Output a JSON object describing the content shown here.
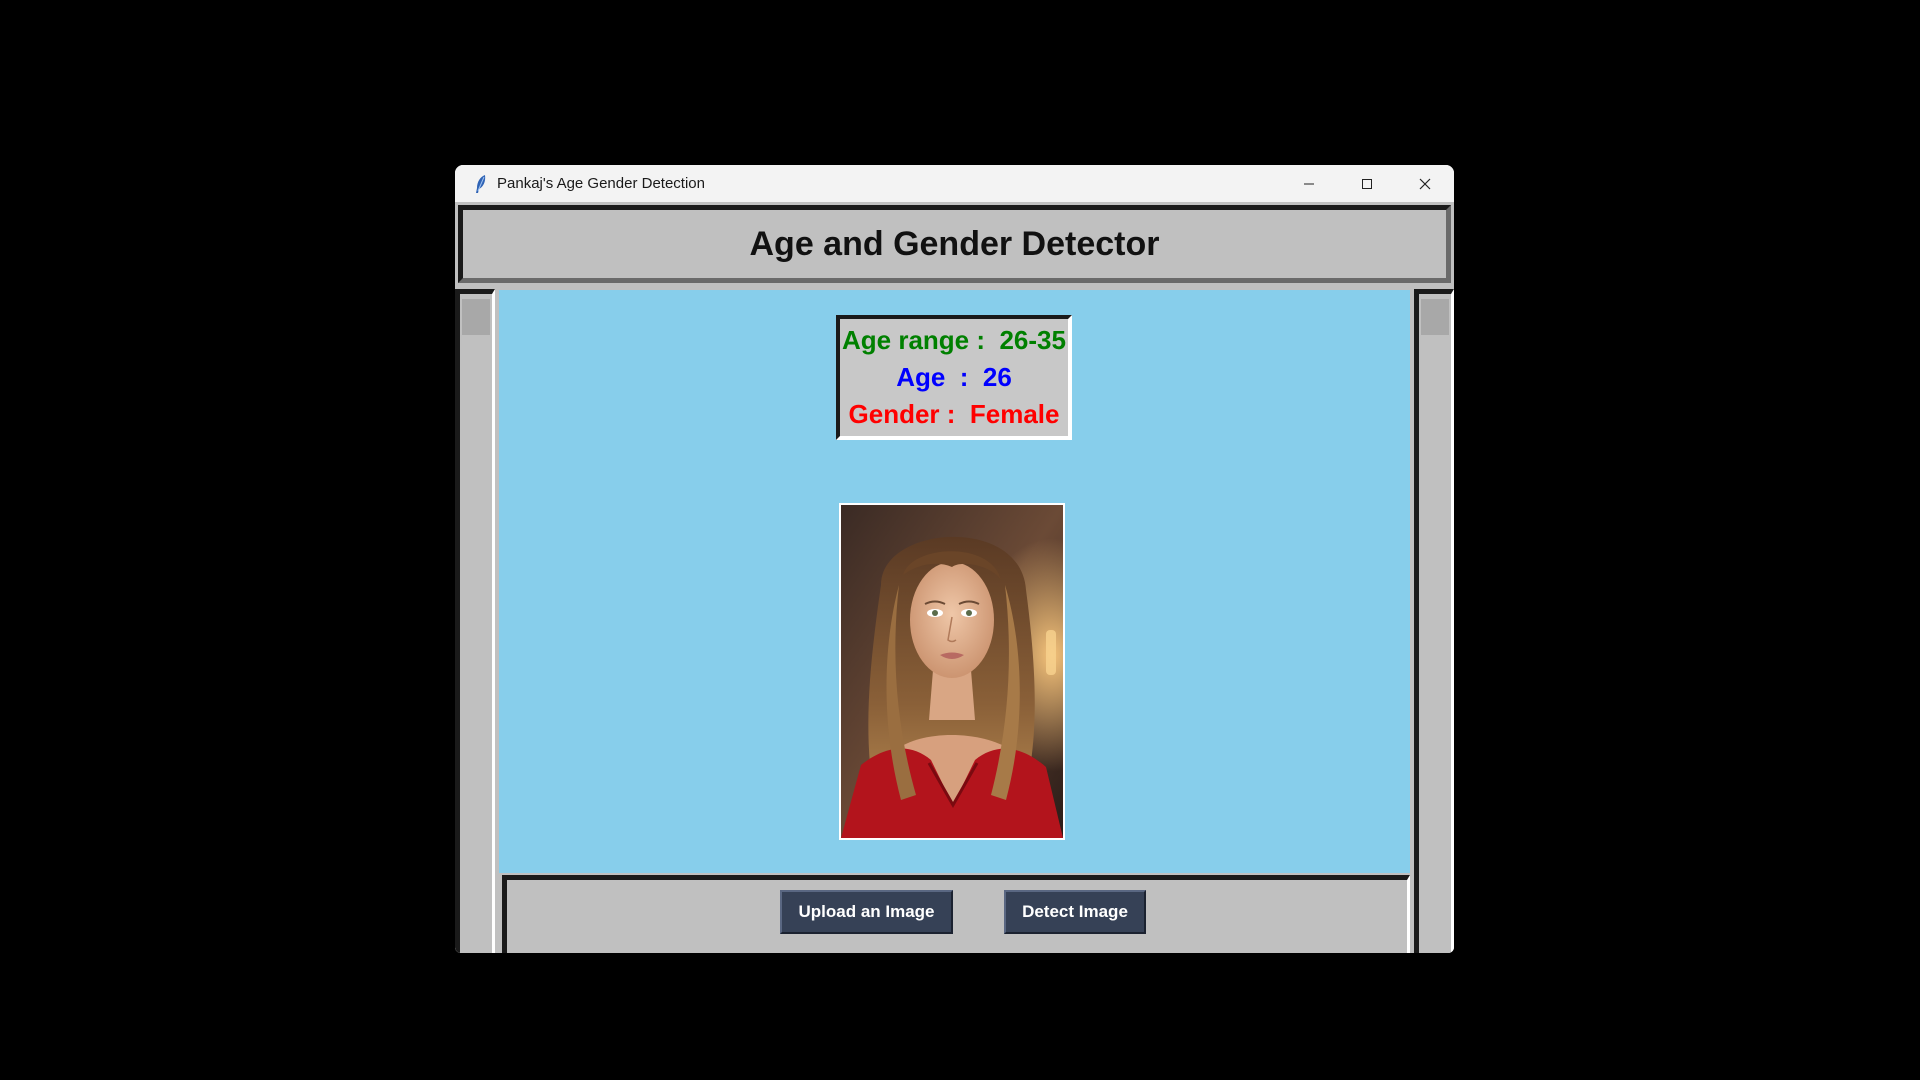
{
  "window": {
    "title": "Pankaj's Age Gender Detection",
    "icon": "feather-icon",
    "controls": [
      "minimize-icon",
      "maximize-icon",
      "close-icon"
    ]
  },
  "header": {
    "title": "Age and Gender Detector"
  },
  "result": {
    "age_range_label": "Age range : ",
    "age_range_value": " 26-35",
    "age_label": "Age  : ",
    "age_value": " 26",
    "gender_label": "Gender : ",
    "gender_value": " Female",
    "colors": {
      "age_range": "#008000",
      "age": "#0000ff",
      "gender": "#ff0000"
    }
  },
  "image": {
    "subject": "portrait of a woman with long wavy hair in a red top"
  },
  "buttons": {
    "upload_label": "Upload an Image",
    "detect_label": "Detect Image"
  },
  "colors": {
    "canvas_bg": "#87ceeb",
    "frame_bg": "#c0c0c0",
    "button_bg": "#364156",
    "button_fg": "#ffffff"
  }
}
